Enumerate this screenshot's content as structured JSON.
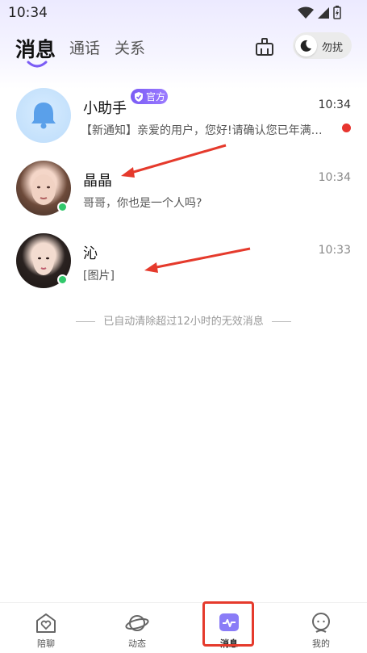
{
  "status_bar": {
    "time": "10:34"
  },
  "header": {
    "tabs": [
      {
        "label": "消息",
        "active": true
      },
      {
        "label": "通话",
        "active": false
      },
      {
        "label": "关系",
        "active": false
      }
    ],
    "dnd_label": "勿扰"
  },
  "conversations": [
    {
      "name": "小助手",
      "badge": "官方",
      "time": "10:34",
      "preview": "【新通知】亲爱的用户，您好!请确认您已年满…",
      "unread": true,
      "online": false,
      "avatar": "bell-icon"
    },
    {
      "name": "晶晶",
      "time": "10:34",
      "preview": "哥哥，你也是一个人吗?",
      "unread": false,
      "online": true,
      "avatar": "user-photo"
    },
    {
      "name": "沁",
      "time": "10:33",
      "preview": "[图片]",
      "unread": false,
      "online": true,
      "avatar": "user-photo"
    }
  ],
  "notice": "已自动清除超过12小时的无效消息",
  "bottom_nav": [
    {
      "label": "陪聊",
      "icon": "heart-house-icon",
      "active": false
    },
    {
      "label": "动态",
      "icon": "planet-icon",
      "active": false
    },
    {
      "label": "消息",
      "icon": "message-icon",
      "active": true
    },
    {
      "label": "我的",
      "icon": "profile-icon",
      "active": false
    }
  ],
  "colors": {
    "accent": "#7b5cf5",
    "online": "#31c86b",
    "unread": "#e7352f",
    "annotation": "#e53a2c"
  }
}
